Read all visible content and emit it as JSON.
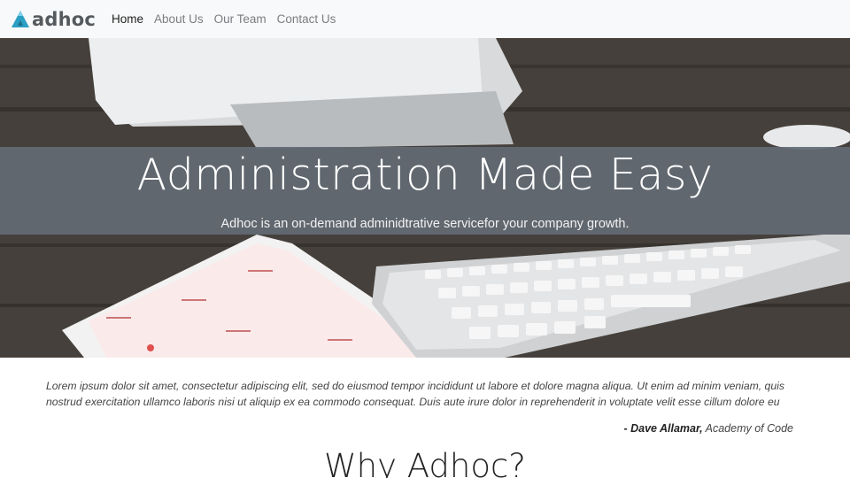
{
  "brand": {
    "name": "adhoc",
    "logo_icon": "triangle-logo-icon"
  },
  "nav": {
    "items": [
      {
        "label": "Home",
        "active": true
      },
      {
        "label": "About Us",
        "active": false
      },
      {
        "label": "Our Team",
        "active": false
      },
      {
        "label": "Contact Us",
        "active": false
      }
    ]
  },
  "hero": {
    "title": "Administration Made Easy",
    "subtitle": "Adhoc is an on-demand adminidtrative servicefor your company growth.",
    "background": "desk-with-monitor-tablet-keyboard-photo"
  },
  "testimonial": {
    "quote": "Lorem ipsum dolor sit amet, consectetur adipiscing elit, sed do eiusmod tempor incididunt ut labore et dolore magna aliqua. Ut enim ad minim veniam, quis nostrud exercitation ullamco laboris nisi ut aliquip ex ea commodo consequat. Duis aute irure dolor in reprehenderit in voluptate velit esse cillum dolore eu",
    "author": "- Dave Allamar,",
    "organization": "Academy of Code"
  },
  "section": {
    "heading": "Why Adhoc?"
  },
  "colors": {
    "navbar_bg": "#f8f9fa",
    "brand_accent": "#2b9fc4",
    "hero_band": "#626a73",
    "text_dark": "#222222"
  }
}
